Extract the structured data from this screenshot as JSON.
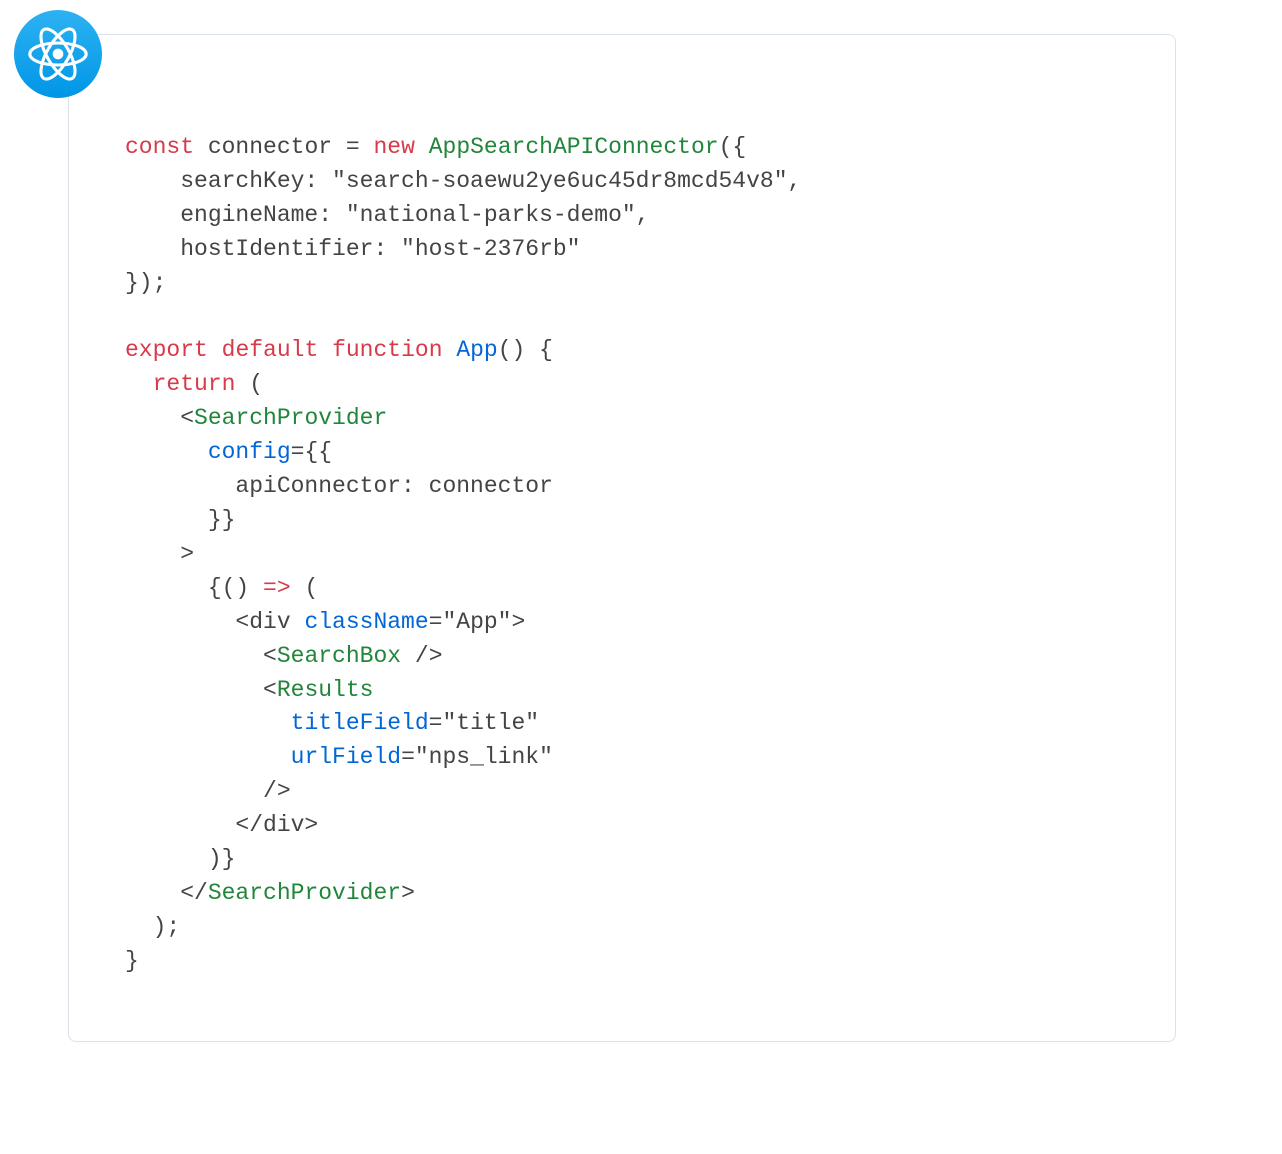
{
  "tokens": {
    "kw_const": "const",
    "id_connector": "connector",
    "eq": " = ",
    "kw_new": "new",
    "cls_connector": "AppSearchAPIConnector",
    "open_call": "({",
    "line_searchKey": "    searchKey: \"search-soaewu2ye6uc45dr8mcd54v8\",",
    "line_engineName": "    engineName: \"national-parks-demo\",",
    "line_hostIdentifier": "    hostIdentifier: \"host-2376rb\"",
    "close_call": "});",
    "kw_export": "export",
    "kw_default": "default",
    "kw_function": "function",
    "id_app": "App",
    "fn_parens": "() {",
    "kw_return": "return",
    "return_open": " (",
    "jsx_open": "<",
    "jsx_close_slash": "</",
    "jsx_selfclose": "/>",
    "sp": "SearchProvider",
    "attr_config": "config",
    "config_eq": "={{",
    "line_apiConnector": "        apiConnector: connector",
    "config_close": "}}",
    "tag_close": ">",
    "child_open": "{() ",
    "arrow": "=>",
    "child_open2": " (",
    "div_open_a": "<div ",
    "attr_className": "className",
    "className_val": "=\"App\">",
    "sb": "SearchBox",
    "res": "Results",
    "attr_titleField": "titleField",
    "titleField_val": "=\"title\"",
    "attr_urlField": "urlField",
    "urlField_val": "=\"nps_link\"",
    "div_close": "</div>",
    "child_close": ")}",
    "return_close": ");",
    "fn_close": "}"
  }
}
